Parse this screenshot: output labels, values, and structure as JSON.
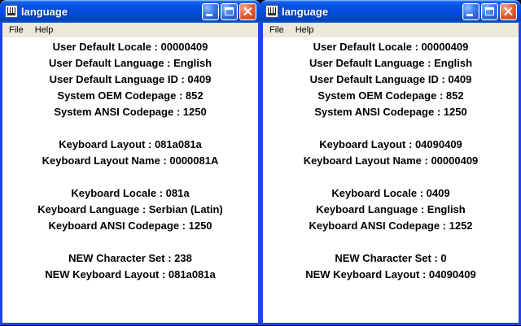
{
  "colors": {
    "window_border": "#1E46E2",
    "titlebar_blue": "#0553E6",
    "close_red": "#D44B22",
    "menubar_bg": "#ECE9D8",
    "client_bg": "#FFFFFF",
    "text": "#000000"
  },
  "windows": [
    {
      "title": "language",
      "menu": [
        "File",
        "Help"
      ],
      "groups": [
        [
          "User Default Locale : 00000409",
          "User Default Language : English",
          "User Default Language ID : 0409",
          "System OEM Codepage : 852",
          "System ANSI Codepage : 1250"
        ],
        [
          "Keyboard Layout : 081a081a",
          "Keyboard Layout Name : 0000081A"
        ],
        [
          "Keyboard Locale : 081a",
          "Keyboard Language : Serbian (Latin)",
          "Keyboard ANSI Codepage : 1250"
        ],
        [
          "NEW Character Set : 238",
          "NEW Keyboard Layout : 081a081a"
        ]
      ]
    },
    {
      "title": "language",
      "menu": [
        "File",
        "Help"
      ],
      "groups": [
        [
          "User Default Locale : 00000409",
          "User Default Language : English",
          "User Default Language ID : 0409",
          "System OEM Codepage : 852",
          "System ANSI Codepage : 1250"
        ],
        [
          "Keyboard Layout : 04090409",
          "Keyboard Layout Name : 00000409"
        ],
        [
          "Keyboard Locale : 0409",
          "Keyboard Language : English",
          "Keyboard ANSI Codepage : 1252"
        ],
        [
          "NEW Character Set : 0",
          "NEW Keyboard Layout : 04090409"
        ]
      ]
    }
  ]
}
